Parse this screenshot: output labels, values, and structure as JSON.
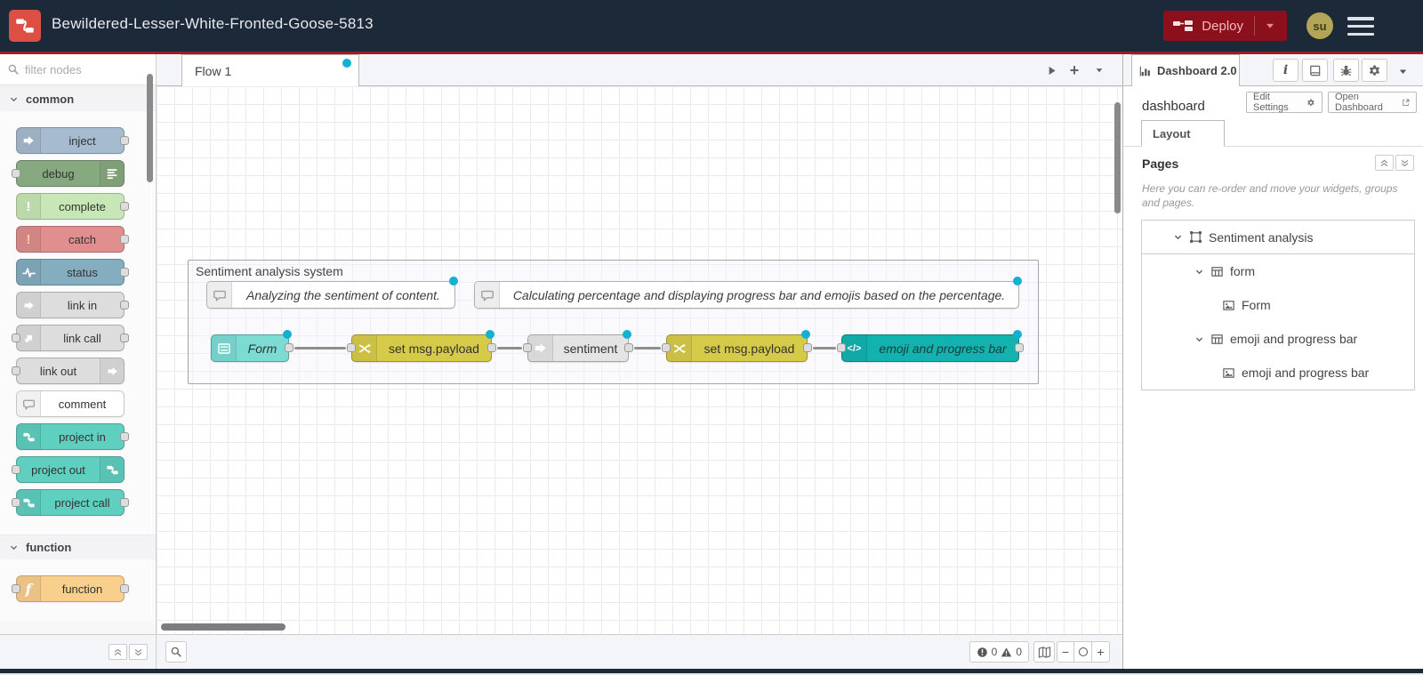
{
  "header": {
    "app_title": "Bewildered-Lesser-White-Fronted-Goose-5813",
    "deploy_label": "Deploy",
    "user_initials": "su"
  },
  "palette": {
    "filter_placeholder": "filter nodes",
    "category_common": "common",
    "category_function": "function",
    "nodes": {
      "inject": "inject",
      "debug": "debug",
      "complete": "complete",
      "catch": "catch",
      "status": "status",
      "link_in": "link in",
      "link_call": "link call",
      "link_out": "link out",
      "comment": "comment",
      "project_in": "project in",
      "project_out": "project out",
      "project_call": "project call",
      "function": "function"
    }
  },
  "workspace": {
    "tab": "Flow 1",
    "group_label": "Sentiment analysis system",
    "comment1": "Analyzing the sentiment of content.",
    "comment2": "Calculating percentage and displaying progress bar and emojis based on the percentage.",
    "nodes": {
      "form": "Form",
      "change1": "set msg.payload",
      "sentiment": "sentiment",
      "change2": "set msg.payload",
      "template": "emoji and progress bar"
    },
    "status_bar": {
      "errors": "0",
      "warnings": "0"
    }
  },
  "sidebar": {
    "tab": "Dashboard 2.0",
    "title": "dashboard",
    "edit_settings": "Edit Settings",
    "open_dashboard": "Open Dashboard",
    "layout_tab": "Layout",
    "pages_title": "Pages",
    "help_text": "Here you can re-order and move your widgets, groups and pages.",
    "tree": {
      "page": "Sentiment analysis",
      "group1": "form",
      "widget1": "Form",
      "group2": "emoji and progress bar",
      "widget2": "emoji and progress bar"
    }
  },
  "glyphs": {
    "exclamation": "!",
    "function_f": "f",
    "code": "</>",
    "info": "i",
    "plus": "+",
    "minus": "−"
  },
  "colors": {
    "header_bg": "#1b2938",
    "accent_red": "#8C101C",
    "header_underline": "#98201f",
    "logo_red": "#dc4f45",
    "change_dot": "#12b0d3",
    "node_inject": "#a6bbcf",
    "node_debug": "#87a980",
    "node_complete": "#c8e7b7",
    "node_catch": "#e08e8e",
    "node_status": "#84aebf",
    "node_link": "#dddddd",
    "node_project": "#5fcfc0",
    "node_function": "#f9cf8e",
    "node_form": "#7cdcd4",
    "node_change": "#d6ca49",
    "node_template": "#14b2ae"
  }
}
